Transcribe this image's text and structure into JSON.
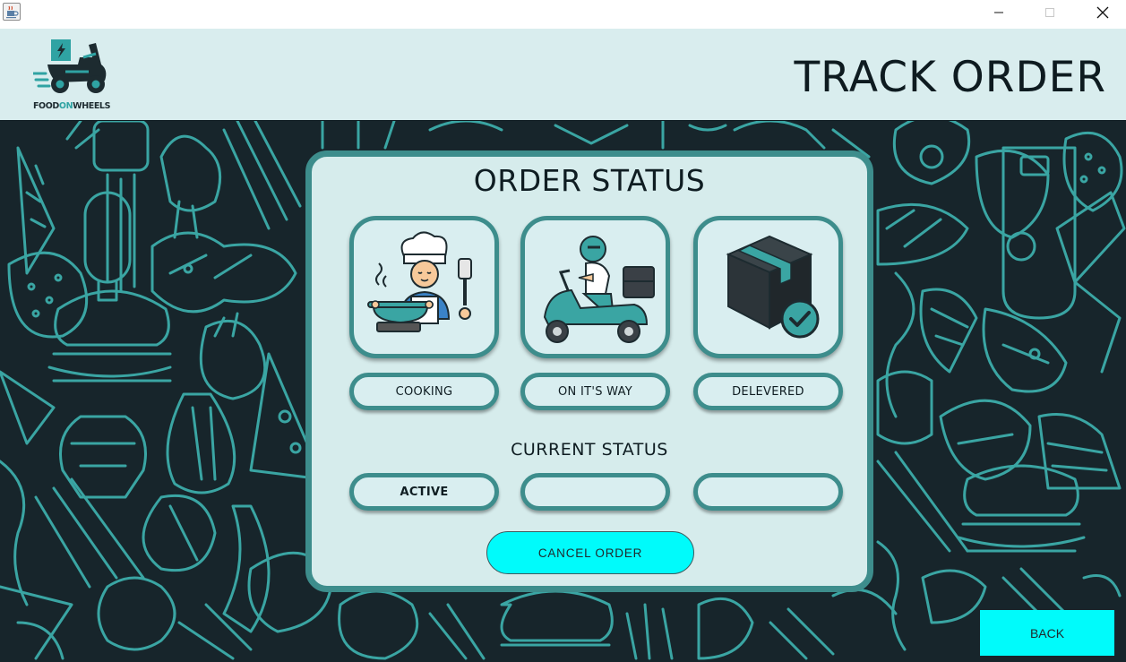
{
  "window": {
    "app_icon": "java-cup-icon",
    "controls": [
      "minimize-icon",
      "maximize-icon",
      "close-icon"
    ]
  },
  "header": {
    "logo": {
      "icon": "delivery-scooter-logo",
      "text_part1": "FOOD",
      "text_part2": "ON",
      "text_part3": "WHEELS"
    },
    "title": "TRACK ORDER"
  },
  "panel": {
    "title": "ORDER STATUS",
    "stages": [
      {
        "icon": "chef-cooking-icon",
        "label": "COOKING"
      },
      {
        "icon": "scooter-delivery-icon",
        "label": "ON IT'S WAY"
      },
      {
        "icon": "delivered-box-icon",
        "label": "DELEVERED"
      }
    ],
    "current_status_label": "CURRENT STATUS",
    "current_status": [
      "ACTIVE",
      "",
      ""
    ],
    "cancel_button": "CANCEL ORDER"
  },
  "back_button": "BACK",
  "colors": {
    "header_bg": "#d9edee",
    "panel_bg": "#d6ecec",
    "teal_border": "#3d8d8c",
    "background_dark": "#17252b",
    "pattern_teal": "#3aa5a3",
    "button_cyan": "#00fbfb"
  }
}
